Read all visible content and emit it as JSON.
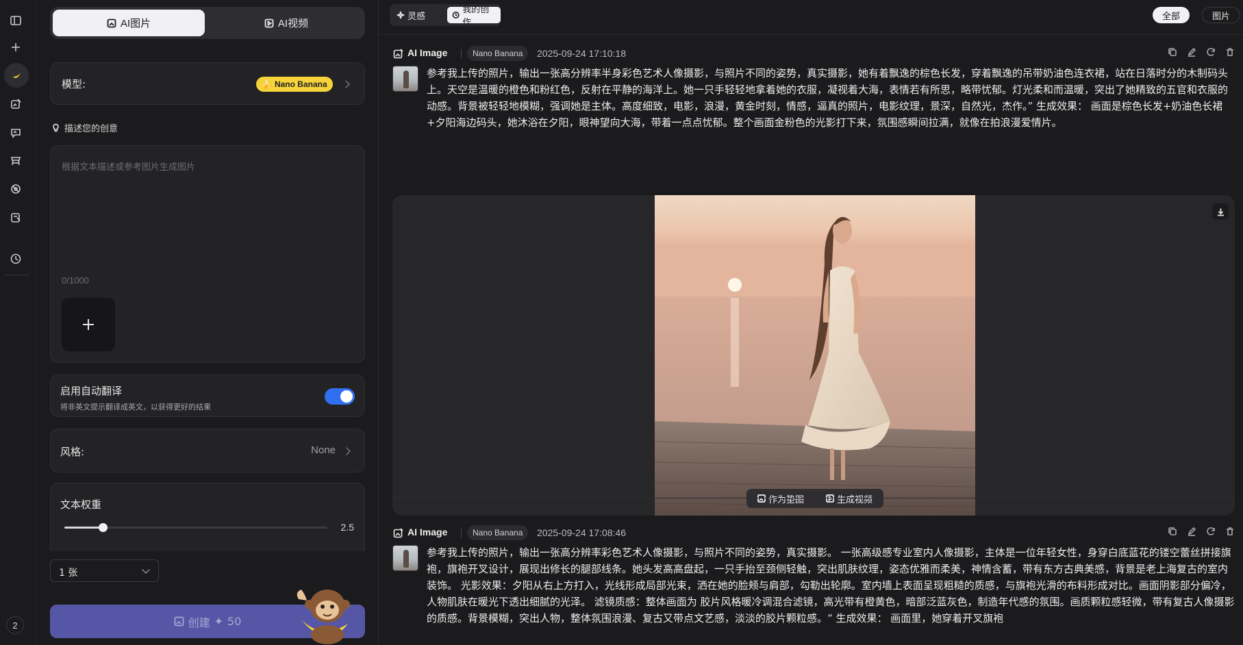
{
  "rail": {
    "badge": "2"
  },
  "panel": {
    "tabs": [
      {
        "label": "AI图片"
      },
      {
        "label": "AI视频"
      }
    ],
    "model": {
      "label": "模型:",
      "value": "Nano Banana"
    },
    "prompt_hint": "描述您的创意",
    "prompt": {
      "placeholder": "根据文本描述或参考图片生成图片",
      "counter": "0/1000"
    },
    "translate": {
      "title": "启用自动翻译",
      "subtitle": "将非英文提示翻译成英文，以获得更好的结果",
      "enabled": true
    },
    "style": {
      "label": "风格:",
      "value": "None"
    },
    "text_weight": {
      "label": "文本权重",
      "value": "2.5",
      "fraction": 0.145
    },
    "count": {
      "value": "1 张"
    },
    "create": {
      "label": "创建",
      "cost": "50"
    }
  },
  "main": {
    "segments": [
      {
        "label": "灵感"
      },
      {
        "label": "我的创作"
      }
    ],
    "filters": [
      {
        "label": "全部"
      },
      {
        "label": "图片"
      }
    ],
    "records": [
      {
        "type": "AI Image",
        "model": "Nano Banana",
        "time": "2025-09-24 17:10:18",
        "prompt": "参考我上传的照片，输出一张高分辨率半身彩色艺术人像摄影，与照片不同的姿势，真实摄影，她有着飘逸的棕色长发，穿着飘逸的吊带奶油色连衣裙，站在日落时分的木制码头上。天空是温暖的橙色和粉红色，反射在平静的海洋上。她一只手轻轻地拿着她的衣服，凝视着大海，表情若有所思，略带忧郁。灯光柔和而温暖，突出了她精致的五官和衣服的动感。背景被轻轻地模糊，强调她是主体。高度细致，电影，浪漫，黄金时刻，情感，逼真的照片，电影纹理，景深，自然光，杰作。” 生成效果： 画面是棕色长发+奶油色长裙+夕阳海边码头，她沐浴在夕阳，眼神望向大海，带着一点点忧郁。整个画面金粉色的光影打下来，氛围感瞬间拉满，就像在拍浪漫爱情片。",
        "action_ref": "作为垫图",
        "action_video": "生成视频"
      },
      {
        "type": "AI Image",
        "model": "Nano Banana",
        "time": "2025-09-24 17:08:46",
        "prompt": "参考我上传的照片，输出一张高分辨率彩色艺术人像摄影，与照片不同的姿势，真实摄影。 一张高级感专业室内人像摄影，主体是一位年轻女性，身穿白底蓝花的镂空蕾丝拼接旗袍，旗袍开叉设计，展现出修长的腿部线条。她头发高高盘起，一只手抬至颈侧轻触，突出肌肤纹理，姿态优雅而柔美，神情含蓄，带有东方古典美感，背景是老上海复古的室内装饰。 光影效果：夕阳从右上方打入，光线形成局部光束，洒在她的脸颊与肩部，勾勒出轮廓。室内墙上表面呈现粗糙的质感，与旗袍光滑的布料形成对比。画面阴影部分偏冷，人物肌肤在暖光下透出细腻的光泽。 滤镜质感：整体画面为 胶片风格暖冷调混合滤镜，高光带有橙黄色，暗部泛蓝灰色，制造年代感的氛围。画质颗粒感轻微，带有复古人像摄影的质感。背景模糊，突出人物，整体氛围浪漫、复古又带点文艺感，淡淡的胶片颗粒感。“ 生成效果： 画面里，她穿着开叉旗袍"
      }
    ]
  }
}
